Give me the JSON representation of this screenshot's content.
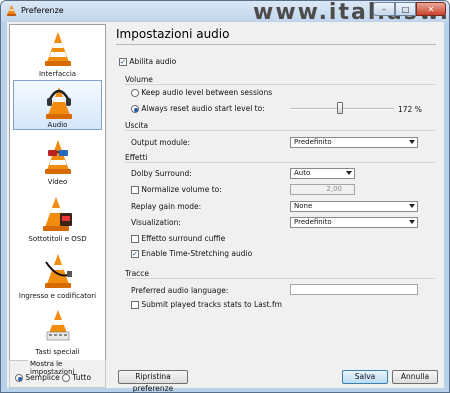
{
  "window": {
    "title": "Preferenze",
    "minimize": "–",
    "maximize": "□",
    "close": "✕"
  },
  "watermark": "www.italiasw.com",
  "sidebar": {
    "items": [
      {
        "label": "Interfaccia",
        "icon": "cone-icon"
      },
      {
        "label": "Audio",
        "icon": "cone-headphones-icon"
      },
      {
        "label": "Video",
        "icon": "cone-glasses-icon"
      },
      {
        "label": "Sottotitoli e OSD",
        "icon": "cone-clock-icon"
      },
      {
        "label": "Ingresso e codificatori",
        "icon": "cone-cable-icon"
      },
      {
        "label": "Tasti speciali",
        "icon": "cone-keys-icon"
      }
    ],
    "selected": "Audio",
    "mode": {
      "title": "Mostra le impostazioni",
      "simple": "Semplice",
      "all": "Tutto",
      "selected": "Semplice"
    }
  },
  "main": {
    "title": "Impostazioni audio",
    "enable_audio": {
      "label": "Abilita audio",
      "checked": true
    },
    "volume": {
      "title": "Volume",
      "keep_label": "Keep audio level between sessions",
      "reset_label": "Always reset audio start level to:",
      "selected": "reset",
      "value": 172,
      "value_text": "172 %"
    },
    "output": {
      "title": "Uscita",
      "module_label": "Output module:",
      "module_value": "Predefinito"
    },
    "effects": {
      "title": "Effetti",
      "dolby_label": "Dolby Surround:",
      "dolby_value": "Auto",
      "normalize_label": "Normalize volume to:",
      "normalize_checked": false,
      "normalize_value": "2,00",
      "replay_label": "Replay gain mode:",
      "replay_value": "None",
      "visualization_label": "Visualization:",
      "visualization_value": "Predefinito",
      "headphone_label": "Effetto surround cuffie",
      "headphone_checked": false,
      "timestretch_label": "Enable Time-Stretching audio",
      "timestretch_checked": true
    },
    "tracks": {
      "title": "Tracce",
      "language_label": "Preferred audio language:",
      "language_value": "",
      "lastfm_label": "Submit played tracks stats to Last.fm",
      "lastfm_checked": false
    }
  },
  "footer": {
    "reset_button": "Ripristina preferenze",
    "save_button": "Salva",
    "cancel_button": "Annulla"
  }
}
